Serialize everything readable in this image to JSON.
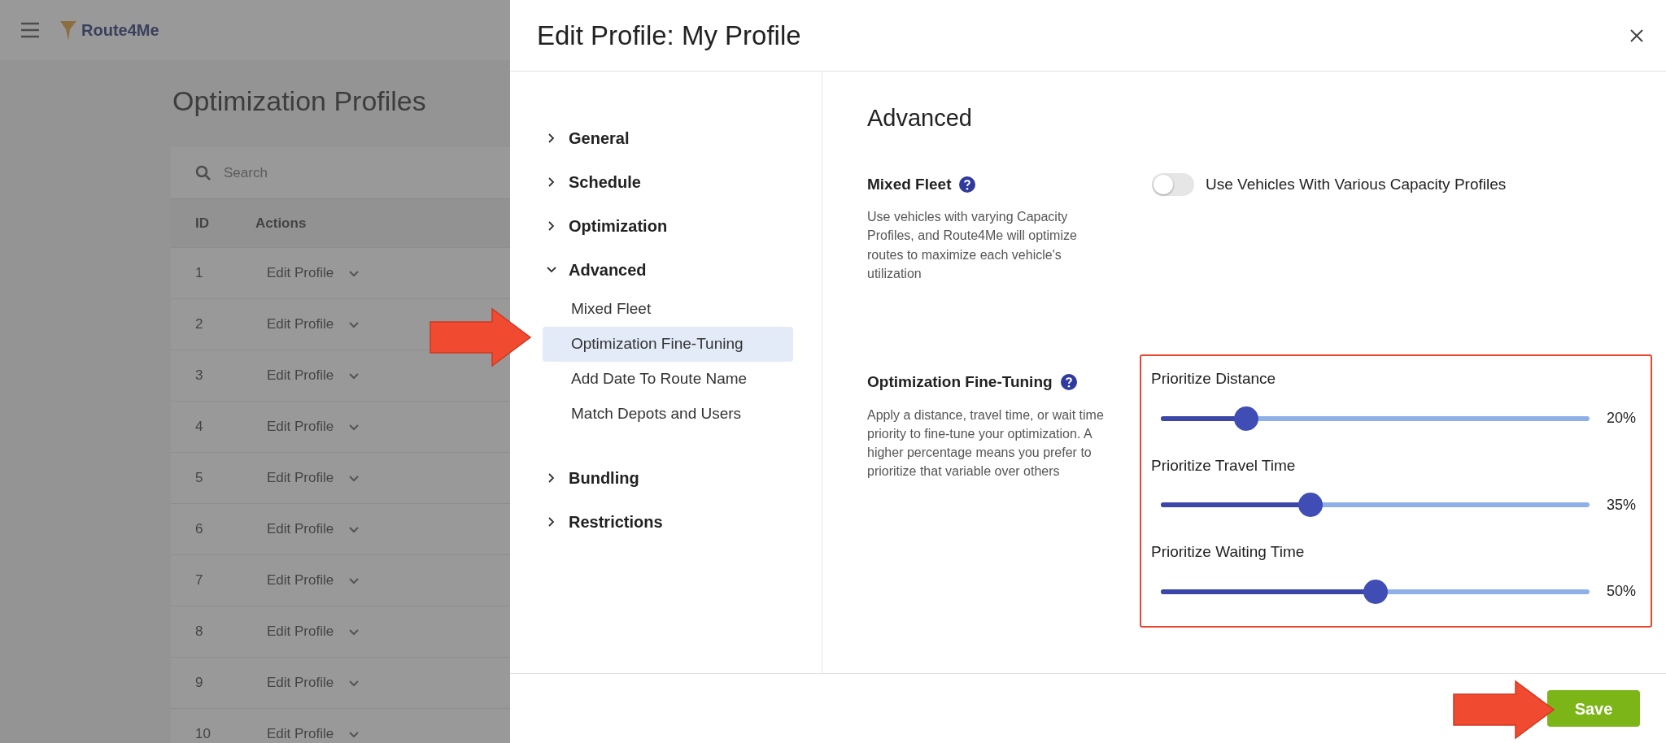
{
  "background_page": {
    "logo": "Route4Me",
    "title": "Optimization Profiles",
    "search": {
      "placeholder": "Search"
    },
    "table": {
      "columns": [
        "ID",
        "Actions"
      ],
      "rows": [
        {
          "id": "1",
          "action": "Edit Profile"
        },
        {
          "id": "2",
          "action": "Edit Profile"
        },
        {
          "id": "3",
          "action": "Edit Profile"
        },
        {
          "id": "4",
          "action": "Edit Profile"
        },
        {
          "id": "5",
          "action": "Edit Profile"
        },
        {
          "id": "6",
          "action": "Edit Profile"
        },
        {
          "id": "7",
          "action": "Edit Profile"
        },
        {
          "id": "8",
          "action": "Edit Profile"
        },
        {
          "id": "9",
          "action": "Edit Profile"
        },
        {
          "id": "10",
          "action": "Edit Profile"
        }
      ]
    }
  },
  "dialog": {
    "title": "Edit Profile: My Profile",
    "nav": [
      {
        "label": "General",
        "expanded": false
      },
      {
        "label": "Schedule",
        "expanded": false
      },
      {
        "label": "Optimization",
        "expanded": false
      },
      {
        "label": "Advanced",
        "expanded": true,
        "children": [
          {
            "label": "Mixed Fleet",
            "selected": false
          },
          {
            "label": "Optimization Fine-Tuning",
            "selected": true
          },
          {
            "label": "Add Date To Route Name",
            "selected": false
          },
          {
            "label": "Match Depots and Users",
            "selected": false
          }
        ]
      },
      {
        "label": "Bundling",
        "expanded": false
      },
      {
        "label": "Restrictions",
        "expanded": false
      }
    ],
    "section_title": "Advanced",
    "settings": [
      {
        "kind": "toggle",
        "title": "Mixed Fleet",
        "description": "Use vehicles with varying Capacity Profiles, and Route4Me will optimize routes to maximize each vehicle's utilization",
        "toggle": {
          "label": "Use Vehicles With Various Capacity Profiles",
          "on": false
        }
      },
      {
        "kind": "sliders",
        "title": "Optimization Fine-Tuning",
        "description": "Apply a distance, travel time, or wait time priority to fine-tune your optimization. A higher percentage means you prefer to prioritize that variable over others",
        "highlighted": true,
        "sliders": [
          {
            "label": "Prioritize Distance",
            "level": 0.2,
            "reading": "20%"
          },
          {
            "label": "Prioritize Travel Time",
            "level": 0.35,
            "reading": "35%"
          },
          {
            "label": "Prioritize Waiting Time",
            "level": 0.5,
            "reading": "50%"
          }
        ]
      }
    ],
    "save_button": "Save"
  }
}
